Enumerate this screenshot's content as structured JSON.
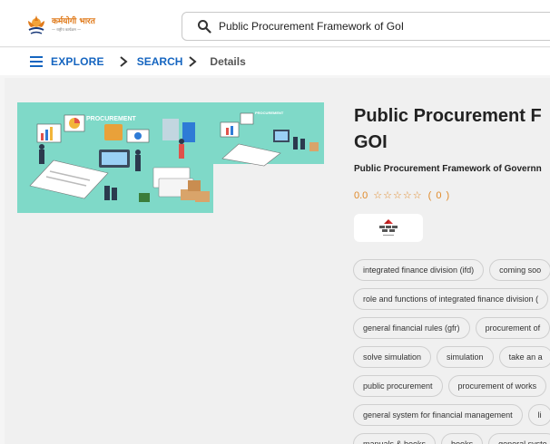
{
  "header": {
    "logo_text": "कर्मयोगी भारत",
    "logo_subtext": "— राष्ट्रीय कार्यक्रम —",
    "search": {
      "value": "Public Procurement Framework of GoI",
      "placeholder": ""
    }
  },
  "breadcrumb": {
    "explore_label": "EXPLORE",
    "search_label": "SEARCH",
    "details_label": "Details"
  },
  "course": {
    "thumbnail_captions": [
      "PROCUREMENT",
      "PROCUREMENT"
    ],
    "title_line1": "Public Procurement F",
    "title_line2": "GOI",
    "subtitle": "Public Procurement Framework of Governn",
    "rating_value": "0.0",
    "rating_stars": "☆☆☆☆☆",
    "rating_count": "( 0 )",
    "rating_fraction": 0
  },
  "tags": [
    [
      "integrated finance division (ifd)",
      "coming soo"
    ],
    [
      "role and functions of integrated finance division ("
    ],
    [
      "general financial rules (gfr)",
      "procurement of"
    ],
    [
      "solve simulation",
      "simulation",
      "take an a"
    ],
    [
      "public procurement",
      "procurement of works"
    ],
    [
      "general system for financial management",
      "li"
    ],
    [
      "manuals & books",
      "books",
      "general syste"
    ]
  ],
  "colors": {
    "accent": "#1565c0",
    "rating": "#e08a2a",
    "thumbnail_bg": "#7fd9c8"
  }
}
